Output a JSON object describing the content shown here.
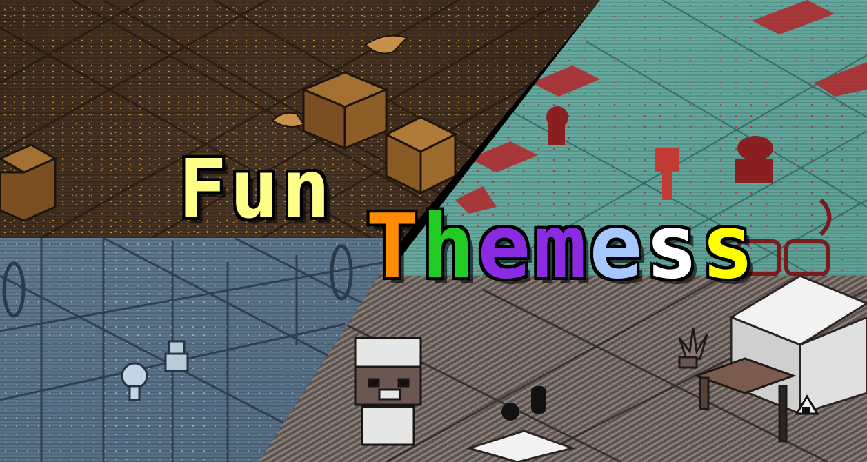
{
  "title": {
    "word1": "Fun",
    "word2_letters": [
      {
        "char": "T",
        "color": "#ff8c00"
      },
      {
        "char": "h",
        "color": "#22cc22"
      },
      {
        "char": "e",
        "color": "#8a2be2"
      },
      {
        "char": "m",
        "color": "#8a2be2"
      },
      {
        "char": "e",
        "color": "#a6c8ff"
      },
      {
        "char": "s",
        "color": "#ffffff"
      },
      {
        "char": "s",
        "color": "#ffff00"
      }
    ],
    "word1_color": "#ffff88"
  },
  "themes": [
    {
      "name": "amber",
      "colors": [
        "#3a291c",
        "#e8b35a",
        "#a06a2a"
      ]
    },
    {
      "name": "teal-red",
      "colors": [
        "#6fb2a8",
        "#b22a2a"
      ]
    },
    {
      "name": "blue",
      "colors": [
        "#4d667d",
        "#b9cfe0"
      ]
    },
    {
      "name": "greyscale",
      "colors": [
        "#5d5450",
        "#ffffff"
      ]
    }
  ]
}
